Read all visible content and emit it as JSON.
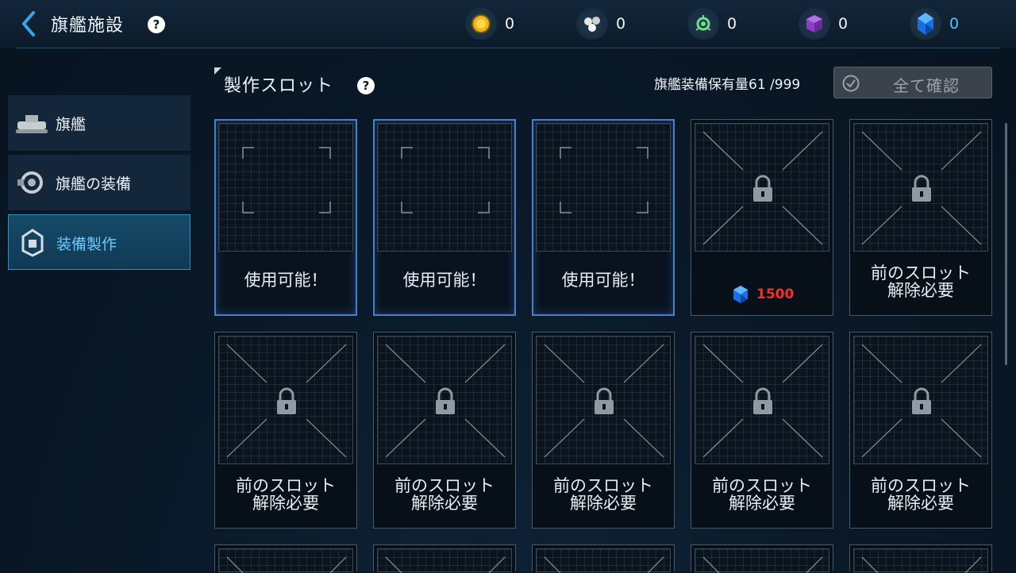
{
  "header": {
    "title": "旗艦施設",
    "resources": [
      {
        "icon": "gold-coin-icon",
        "value": "0"
      },
      {
        "icon": "alloy-icon",
        "value": "0"
      },
      {
        "icon": "crystal-node-icon",
        "value": "0"
      },
      {
        "icon": "purple-cube-icon",
        "value": "0"
      },
      {
        "icon": "blue-gem-icon",
        "value": "0"
      }
    ]
  },
  "sidebar": {
    "items": [
      {
        "label": "旗艦",
        "icon": "flagship-icon",
        "active": false
      },
      {
        "label": "旗艦の装備",
        "icon": "equipment-icon",
        "active": false
      },
      {
        "label": "装備製作",
        "icon": "crafting-icon",
        "active": true
      }
    ]
  },
  "main": {
    "section_title": "製作スロット",
    "stock_text": "旗艦装備保有量61 /999",
    "confirm_all_label": "全て確認",
    "slots": [
      {
        "state": "available",
        "label": "使用可能！"
      },
      {
        "state": "available",
        "label": "使用可能！"
      },
      {
        "state": "available",
        "label": "使用可能！"
      },
      {
        "state": "purchasable",
        "cost": "1500"
      },
      {
        "state": "locked",
        "label_line1": "前のスロット",
        "label_line2": "解除必要"
      },
      {
        "state": "locked",
        "label_line1": "前のスロット",
        "label_line2": "解除必要"
      },
      {
        "state": "locked",
        "label_line1": "前のスロット",
        "label_line2": "解除必要"
      },
      {
        "state": "locked",
        "label_line1": "前のスロット",
        "label_line2": "解除必要"
      },
      {
        "state": "locked",
        "label_line1": "前のスロット",
        "label_line2": "解除必要"
      },
      {
        "state": "locked",
        "label_line1": "前のスロット",
        "label_line2": "解除必要"
      }
    ]
  },
  "colors": {
    "accent_blue": "#6cc9ff",
    "available_border": "#4b7fc9",
    "cost_red": "#ff2a2a"
  }
}
